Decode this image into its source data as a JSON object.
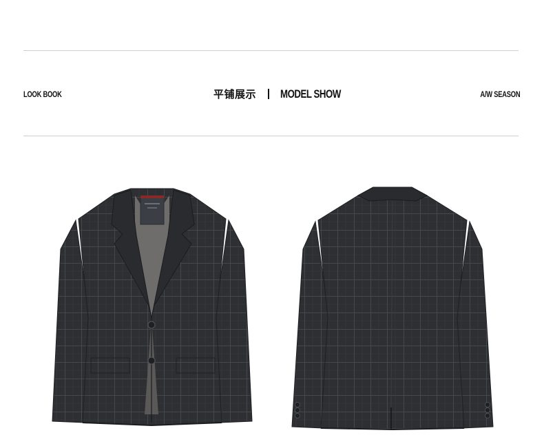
{
  "header": {
    "left": "LOOK BOOK",
    "center_cn": "平铺展示",
    "center_en": "MODEL SHOW",
    "right": "A/W SEASON"
  },
  "images": [
    {
      "name": "front-view",
      "icon": "jacket-front"
    },
    {
      "name": "back-view",
      "icon": "jacket-back"
    }
  ],
  "colors": {
    "fabric": "#2e2f33",
    "fabric_dark": "#1f2023",
    "check_line": "#44464c",
    "lining": "#6e6d6b",
    "label": "#3b3f45",
    "label_red": "#8a2a27",
    "rule": "#cfcfcf"
  }
}
